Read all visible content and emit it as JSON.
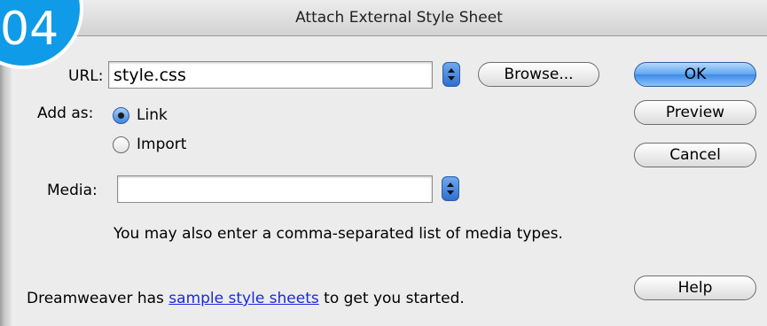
{
  "window": {
    "title": "Attach External Style Sheet"
  },
  "badge": {
    "text": "04"
  },
  "url": {
    "label": "URL:",
    "value": "style.css",
    "browse_label": "Browse..."
  },
  "add_as": {
    "label": "Add as:",
    "options": [
      {
        "label": "Link",
        "selected": true
      },
      {
        "label": "Import",
        "selected": false
      }
    ]
  },
  "media": {
    "label": "Media:",
    "value": "",
    "hint": "You may also enter a comma-separated list of media types."
  },
  "buttons": {
    "ok": "OK",
    "preview": "Preview",
    "cancel": "Cancel",
    "help": "Help"
  },
  "footer": {
    "prefix": "Dreamweaver has ",
    "link": "sample style sheets",
    "suffix": " to get you started."
  },
  "colors": {
    "badge": "#0f9be7",
    "link": "#1a2bd8",
    "default_button": "#5ea6f2"
  }
}
